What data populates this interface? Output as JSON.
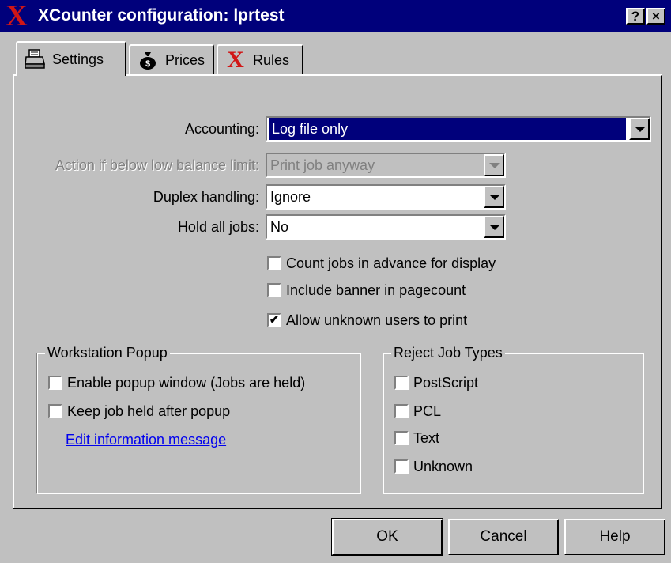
{
  "window": {
    "title": "XCounter configuration: lprtest",
    "help_button": "?",
    "close_button": "×",
    "logo_glyph": "X"
  },
  "tabs": [
    {
      "label": "Settings",
      "icon": "printer-icon"
    },
    {
      "label": "Prices",
      "icon": "money-bag-icon"
    },
    {
      "label": "Rules",
      "icon": "xcounter-x-icon",
      "glyph": "X"
    }
  ],
  "settings": {
    "accounting": {
      "label": "Accounting:",
      "value": "Log file only"
    },
    "low_balance": {
      "label": "Action if below low balance limit:",
      "value": "Print job anyway"
    },
    "duplex": {
      "label": "Duplex handling:",
      "value": "Ignore"
    },
    "hold_all": {
      "label": "Hold all jobs:",
      "value": "No"
    },
    "checkboxes": [
      {
        "label": "Count jobs in advance for display",
        "checked": false
      },
      {
        "label": "Include banner in pagecount",
        "checked": false
      },
      {
        "label": "Allow unknown users to print",
        "checked": true
      }
    ]
  },
  "workstation_popup": {
    "title": "Workstation Popup",
    "enable_popup": {
      "label": "Enable popup window (Jobs are held)",
      "checked": false
    },
    "keep_held": {
      "label": "Keep job held after popup",
      "checked": false
    },
    "edit_link": "Edit information message"
  },
  "reject_job_types": {
    "title": "Reject Job Types",
    "items": [
      {
        "label": "PostScript",
        "checked": false
      },
      {
        "label": "PCL",
        "checked": false
      },
      {
        "label": "Text",
        "checked": false
      },
      {
        "label": "Unknown",
        "checked": false
      }
    ]
  },
  "buttons": {
    "ok": "OK",
    "cancel": "Cancel",
    "help": "Help"
  },
  "check_glyph": "✔",
  "colors": {
    "title_bar": "#00007b",
    "face": "#c0c0c0",
    "selection": "#00007b",
    "logo_red": "#d11616",
    "link": "#0000ee"
  }
}
